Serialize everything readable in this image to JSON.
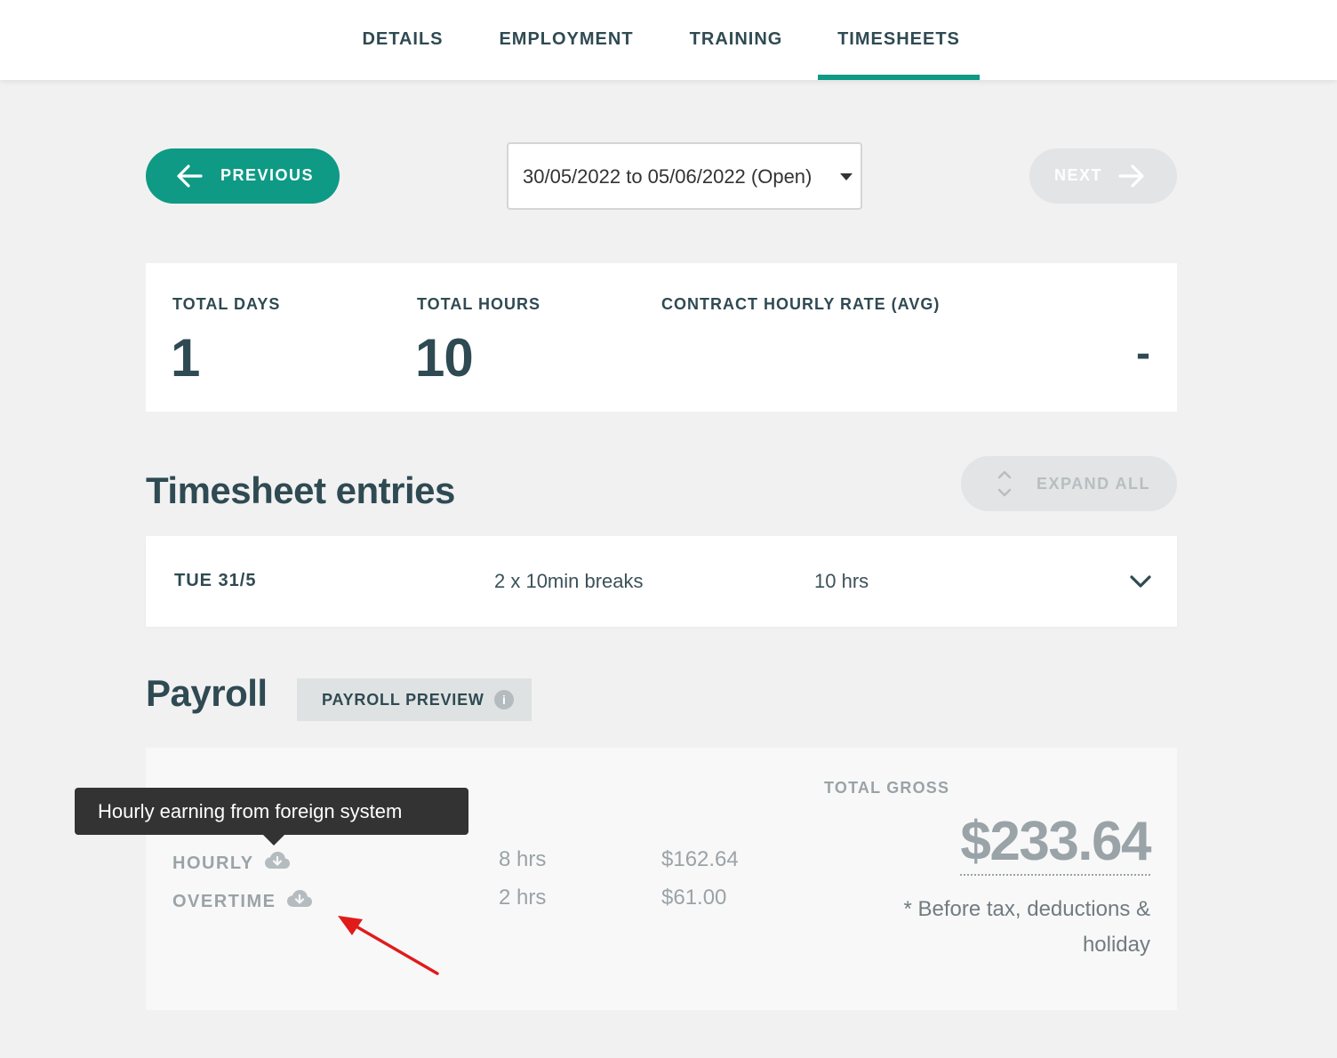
{
  "nav": {
    "tabs": [
      {
        "label": "DETAILS",
        "active": false
      },
      {
        "label": "EMPLOYMENT",
        "active": false
      },
      {
        "label": "TRAINING",
        "active": false
      },
      {
        "label": "TIMESHEETS",
        "active": true
      }
    ]
  },
  "period": {
    "previous_label": "PREVIOUS",
    "next_label": "NEXT",
    "selected": "30/05/2022 to 05/06/2022 (Open)"
  },
  "summary": {
    "total_days_label": "TOTAL DAYS",
    "total_days": "1",
    "total_hours_label": "TOTAL HOURS",
    "total_hours": "10",
    "rate_label": "CONTRACT HOURLY RATE (AVG)",
    "rate_value": "-"
  },
  "entries": {
    "title": "Timesheet entries",
    "expand_all_label": "EXPAND ALL",
    "rows": [
      {
        "date": "TUE 31/5",
        "breaks": "2 x 10min breaks",
        "hours": "10 hrs"
      }
    ]
  },
  "payroll": {
    "title": "Payroll",
    "preview_label": "PAYROLL PREVIEW",
    "info_icon": "i",
    "earnings": [
      {
        "label": "HOURLY",
        "hours": "8 hrs",
        "amount": "$162.64",
        "icon": "cloud-download-icon"
      },
      {
        "label": "OVERTIME",
        "hours": "2 hrs",
        "amount": "$61.00",
        "icon": "cloud-download-icon"
      }
    ],
    "total_gross_label": "TOTAL GROSS",
    "total_gross": "$233.64",
    "note": "* Before tax, deductions & holiday"
  },
  "tooltip": {
    "text": "Hourly earning from foreign system"
  },
  "colors": {
    "accent": "#0e9a85",
    "text_dark": "#2f4a52",
    "muted": "#9aa3a7",
    "annotation_arrow": "#e01b1b"
  }
}
